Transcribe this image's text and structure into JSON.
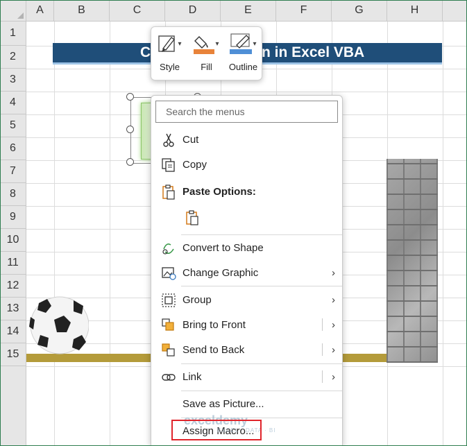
{
  "columns": [
    "A",
    "B",
    "C",
    "D",
    "E",
    "F",
    "G",
    "H"
  ],
  "rows": [
    "1",
    "2",
    "3",
    "4",
    "5",
    "6",
    "7",
    "8",
    "9",
    "10",
    "11",
    "12",
    "13",
    "14",
    "15"
  ],
  "title_banner": {
    "text_left": "C",
    "text_right": "n in Excel VBA"
  },
  "mini_toolbar": {
    "style_label": "Style",
    "fill_label": "Fill",
    "outline_label": "Outline",
    "accent_fill": "#e8833a",
    "accent_outline": "#4f8fd6"
  },
  "context_menu": {
    "search_placeholder": "Search the menus",
    "items": {
      "cut": "Cut",
      "copy": "Copy",
      "paste_options": "Paste Options:",
      "convert_to_shape": "Convert to Shape",
      "change_graphic": "Change Graphic",
      "group": "Group",
      "bring_to_front": "Bring to Front",
      "send_to_back": "Send to Back",
      "link": "Link",
      "save_as_picture": "Save as Picture...",
      "assign_macro": "Assign Macro..."
    },
    "submenu_glyph": "›"
  },
  "watermark": {
    "brand": "exceldemy",
    "tagline": "EXCEL · DATA · BI"
  },
  "colors": {
    "header_bg": "#1f4e79",
    "highlight": "#e0242b",
    "ground": "#b49b3a"
  }
}
